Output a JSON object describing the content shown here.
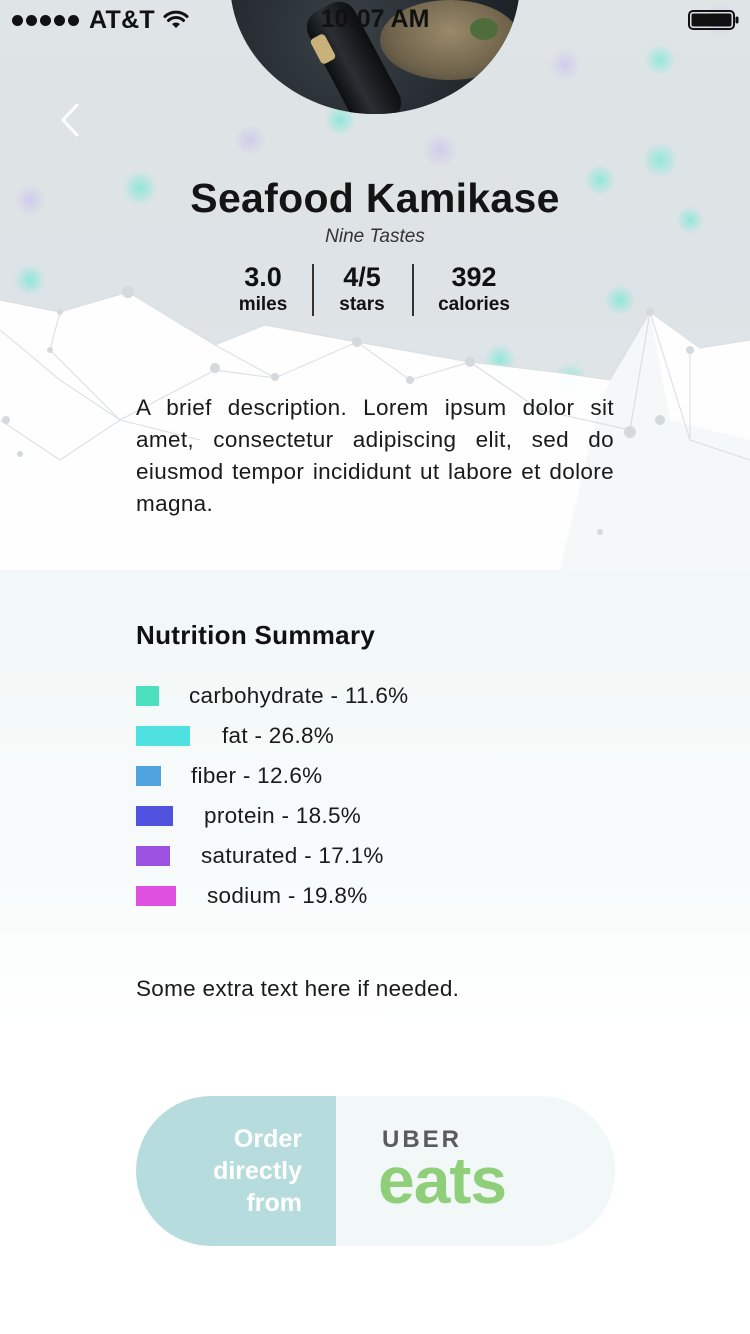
{
  "status_bar": {
    "carrier": "AT&T",
    "time": "10:07 AM"
  },
  "header": {
    "back_icon": "chevron-left-icon",
    "title": "Seafood Kamikase",
    "restaurant": "Nine Tastes"
  },
  "stats": [
    {
      "value": "3.0",
      "label": "miles"
    },
    {
      "value": "4/5",
      "label": "stars"
    },
    {
      "value": "392",
      "label": "calories"
    }
  ],
  "description": "A brief description. Lorem ipsum dolor sit amet, consectetur adipiscing elit, sed do eiusmod tempor incididunt ut labore et dolore magna.",
  "nutrition": {
    "title": "Nutrition Summary",
    "items": [
      {
        "label": "carbohydrate - 11.6%",
        "percent": 11.6,
        "color": "#4de0bf"
      },
      {
        "label": "fat - 26.8%",
        "percent": 26.8,
        "color": "#4fe0e0"
      },
      {
        "label": "fiber - 12.6%",
        "percent": 12.6,
        "color": "#4fa4e0"
      },
      {
        "label": "protein - 18.5%",
        "percent": 18.5,
        "color": "#4f53e0"
      },
      {
        "label": "saturated - 17.1%",
        "percent": 17.1,
        "color": "#9b52e0"
      },
      {
        "label": "sodium - 19.8%",
        "percent": 19.8,
        "color": "#e050e0"
      }
    ]
  },
  "extra_text": "Some extra text here if needed.",
  "order": {
    "line1": "Order",
    "line2": "directly",
    "line3": "from",
    "brand_top": "UBER",
    "brand_bottom": "eats",
    "brand_color": "#8fcf7a"
  }
}
